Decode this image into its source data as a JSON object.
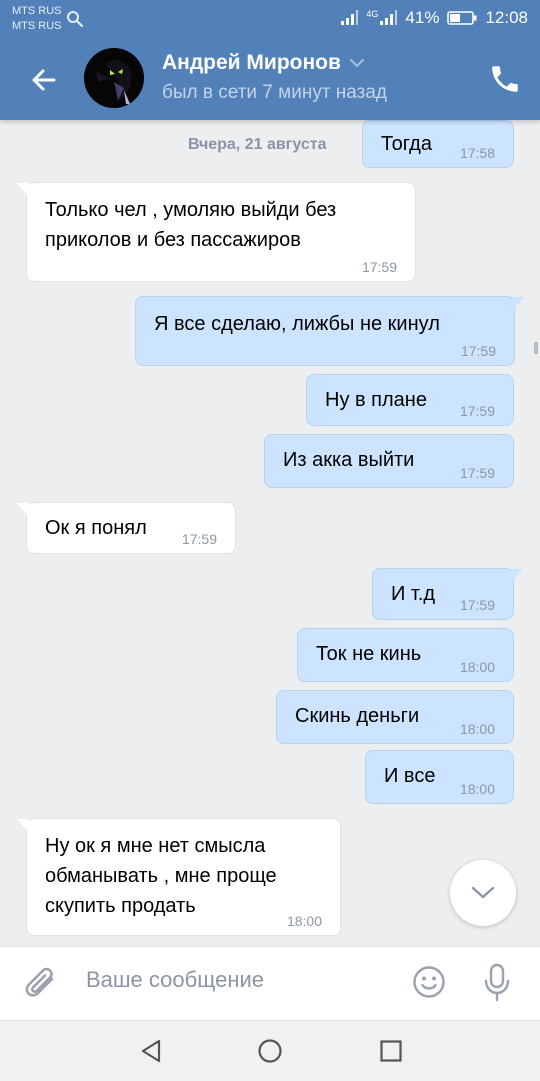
{
  "status_bar": {
    "carrier_1": "MTS RUS",
    "carrier_2": "MTS RUS",
    "network_label": "4G",
    "battery_percent": "41%",
    "time": "12:08"
  },
  "header": {
    "contact_name": "Андрей Миронов",
    "last_seen": "был в сети 7 минут назад"
  },
  "chat": {
    "date_label": "Вчера, 21 августа",
    "messages": [
      {
        "dir": "out",
        "text": "Тогда",
        "time": "17:58"
      },
      {
        "dir": "in",
        "text": "Только чел , умоляю выйди без приколов и без пассажиров",
        "time": "17:59"
      },
      {
        "dir": "out",
        "text": "Я все сделаю, лижбы не кинул",
        "time": "17:59"
      },
      {
        "dir": "out",
        "text": "Ну в плане",
        "time": "17:59"
      },
      {
        "dir": "out",
        "text": "Из акка выйти",
        "time": "17:59"
      },
      {
        "dir": "in",
        "text": "Ок я понял",
        "time": "17:59"
      },
      {
        "dir": "out",
        "text": "И т.д",
        "time": "17:59"
      },
      {
        "dir": "out",
        "text": "Ток не кинь",
        "time": "18:00"
      },
      {
        "dir": "out",
        "text": "Скинь деньги",
        "time": "18:00"
      },
      {
        "dir": "out",
        "text": "И все",
        "time": "18:00"
      },
      {
        "dir": "in",
        "text": "Ну ок я мне нет смысла обманывать , мне проще скупить продать",
        "time": "18:00"
      }
    ]
  },
  "composer": {
    "placeholder": "Ваше сообщение"
  },
  "icons": {
    "search": "search-icon",
    "back": "arrow-left-icon",
    "dropdown": "chevron-down-icon",
    "call": "phone-icon",
    "scroll_down": "chevron-down-icon",
    "attach": "paperclip-icon",
    "emoji": "smile-icon",
    "voice": "microphone-icon"
  },
  "colors": {
    "brand": "#5181b8",
    "incoming_bubble": "#ffffff",
    "outgoing_bubble": "#cce4ff",
    "background": "#edeef0"
  }
}
